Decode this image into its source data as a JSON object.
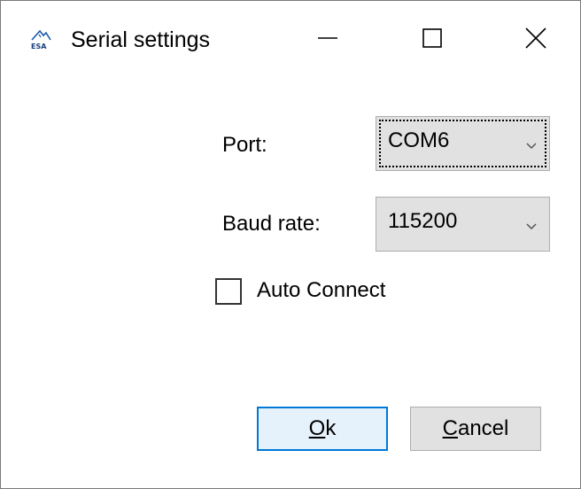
{
  "window": {
    "title": "Serial settings"
  },
  "icons": {
    "app": "esa-logo-icon",
    "minimize": "minimize-icon",
    "maximize": "maximize-icon",
    "close": "close-icon",
    "dropdown": "chevron-down-icon"
  },
  "form": {
    "port_label": "Port:",
    "port_value": "COM6",
    "baud_label": "Baud rate:",
    "baud_value": "115200",
    "auto_connect_label": "Auto Connect",
    "auto_connect_checked": false
  },
  "buttons": {
    "ok_mnemonic": "O",
    "ok_rest": "k",
    "cancel_mnemonic": "C",
    "cancel_rest": "ancel"
  },
  "colors": {
    "accent": "#0078d7",
    "button_face": "#e1e1e1",
    "button_border": "#adadad"
  }
}
